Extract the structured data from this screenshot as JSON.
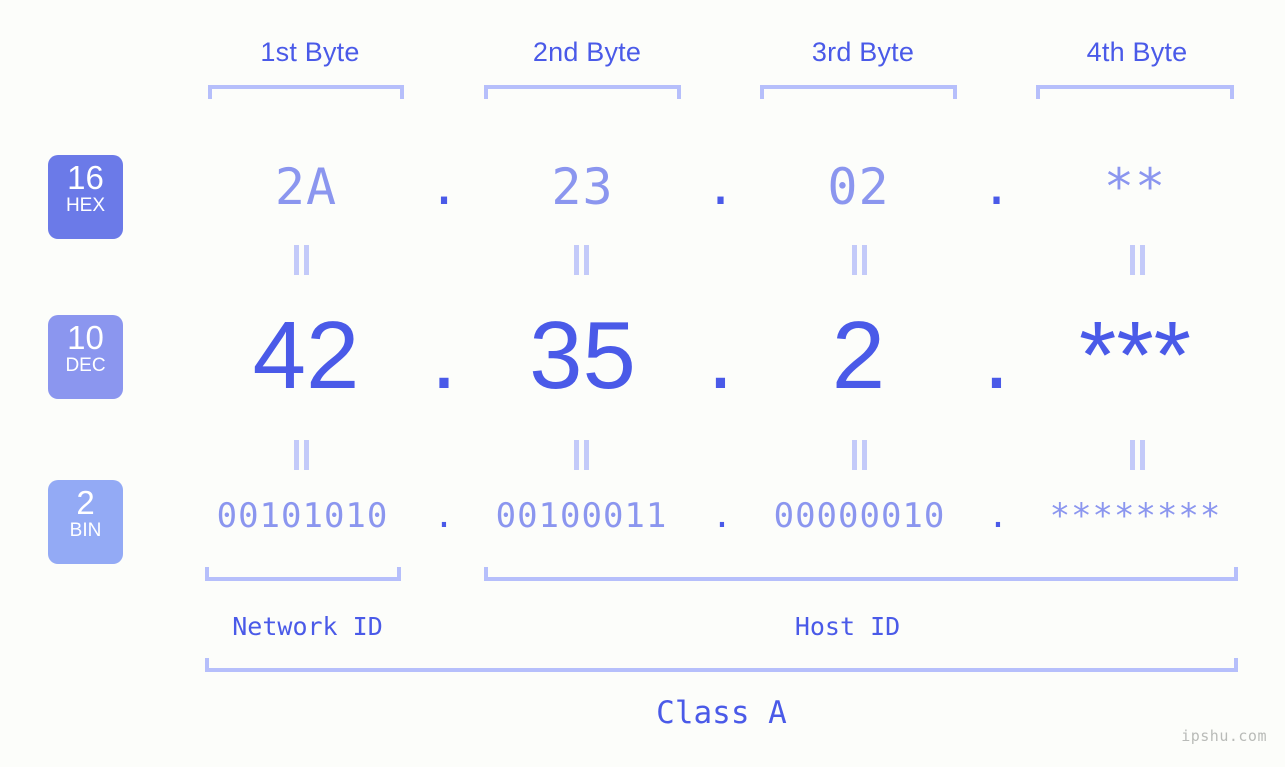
{
  "page": {
    "background": "#fcfdfa",
    "accent": "#4a5ae8",
    "accent_light": "#8b96ef",
    "accent_pale": "#b6bffb",
    "watermark": "ipshu.com"
  },
  "byte_headers": [
    {
      "label": "1st Byte"
    },
    {
      "label": "2nd Byte"
    },
    {
      "label": "3rd Byte"
    },
    {
      "label": "4th Byte"
    }
  ],
  "bases": [
    {
      "radix": "16",
      "abbr": "HEX",
      "color": "#6b7ae8"
    },
    {
      "radix": "10",
      "abbr": "DEC",
      "color": "#8b96ef"
    },
    {
      "radix": "2",
      "abbr": "BIN",
      "color": "#93aaf5"
    }
  ],
  "rows": {
    "hex": {
      "values": [
        "2A",
        "23",
        "02",
        "**"
      ],
      "separator": "."
    },
    "dec": {
      "values": [
        "42",
        "35",
        "2",
        "***"
      ],
      "separator": "."
    },
    "bin": {
      "values": [
        "00101010",
        "00100011",
        "00000010",
        "********"
      ],
      "separator": "."
    }
  },
  "separators": {
    "eq_symbol": "="
  },
  "footer": {
    "network_id": "Network ID",
    "host_id": "Host ID",
    "class": "Class A"
  }
}
